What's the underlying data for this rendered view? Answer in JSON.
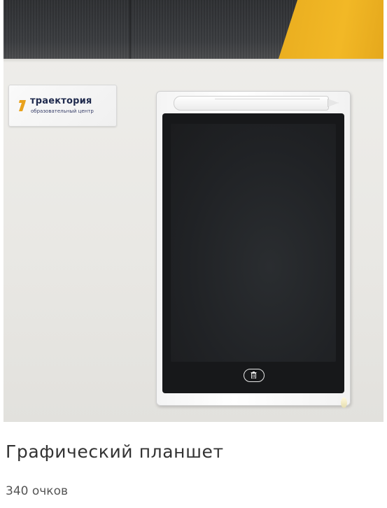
{
  "product": {
    "title": "Графический планшет",
    "price": "340 очков"
  },
  "photo": {
    "sticker": {
      "brand": "траектория",
      "subtitle": "образовательный центр"
    },
    "colors": {
      "brand_orange": "#e9a21c",
      "brand_navy": "#1f2a4d",
      "tablet_white": "#f7f7f7",
      "screen_black": "#1f2123",
      "fabric_yellow": "#f2b826"
    },
    "icons": [
      "trash-icon"
    ]
  }
}
